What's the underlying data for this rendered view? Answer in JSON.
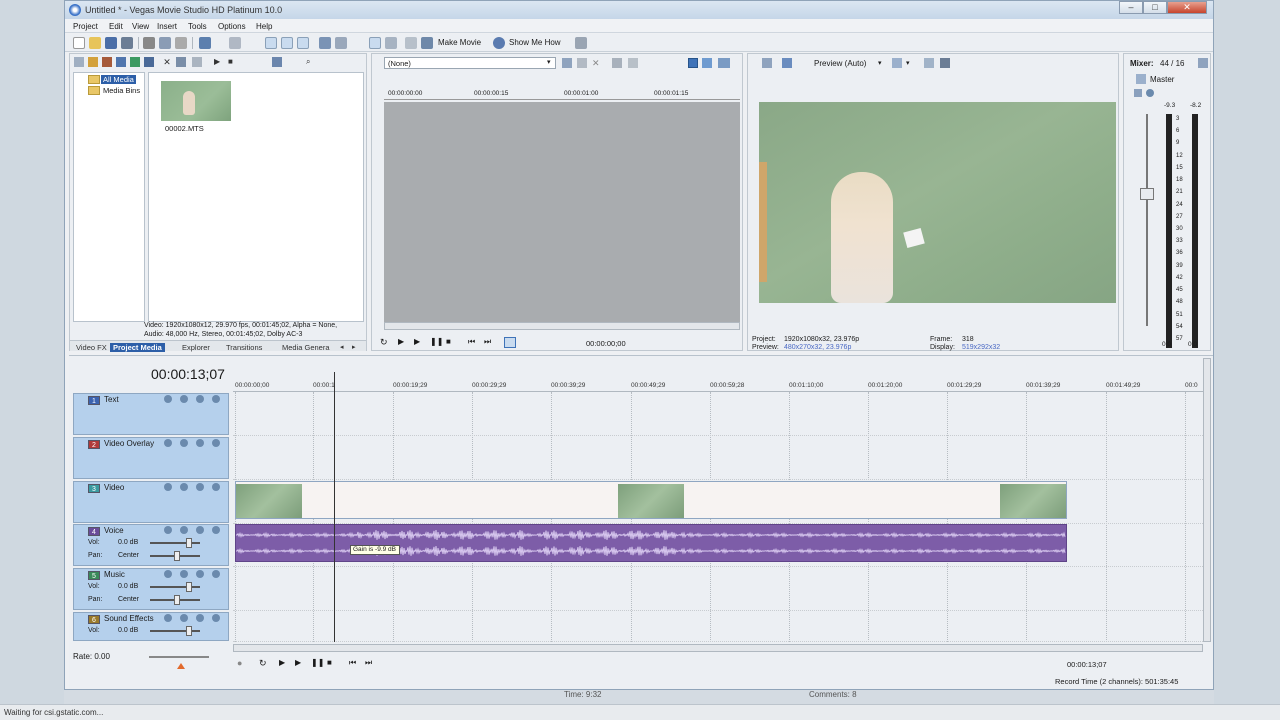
{
  "window": {
    "title": "Untitled * - Vegas Movie Studio HD Platinum 10.0"
  },
  "menu": [
    "Project",
    "Edit",
    "View",
    "Insert",
    "Tools",
    "Options",
    "Help"
  ],
  "toolbar": {
    "make_movie": "Make Movie",
    "show_me_how": "Show Me How"
  },
  "explorer": {
    "tree": [
      "All Media",
      "Media Bins"
    ],
    "file": "00002.MTS",
    "info_line1": "Video: 1920x1080x12, 29.970 fps, 00:01:45;02, Alpha = None,",
    "info_line2": "Audio: 48,000 Hz, Stereo, 00:01:45;02, Dolby AC-3",
    "tabs": [
      "Video FX",
      "Project Media",
      "Explorer",
      "Transitions",
      "Media Genera"
    ]
  },
  "trimmer": {
    "dropdown": "(None)",
    "ruler": [
      "00:00:00:00",
      "00:00:00:15",
      "00:00:01:00",
      "00:00:01:15"
    ],
    "time": "00:00:00;00"
  },
  "preview": {
    "label": "Preview (Auto)",
    "project_label": "Project:",
    "project_value": "1920x1080x32, 23.976p",
    "preview_label": "Preview:",
    "preview_value": "480x270x32, 23.976p",
    "frame_label": "Frame:",
    "frame_value": "318",
    "display_label": "Display:",
    "display_value": "519x292x32"
  },
  "mixer": {
    "label": "Mixer:",
    "count": "44 / 16",
    "master": "Master",
    "peak_left": "-9.3",
    "peak_right": "-8.2",
    "scale": [
      "3",
      "6",
      "9",
      "12",
      "15",
      "18",
      "21",
      "24",
      "27",
      "30",
      "33",
      "36",
      "39",
      "42",
      "45",
      "48",
      "51",
      "54",
      "57"
    ],
    "bottom_left": "0.0",
    "bottom_right": "0.0"
  },
  "timeline": {
    "timecode": "00:00:13;07",
    "ruler": [
      "00:00:00;00",
      "00:00:1",
      "00:00:19;29",
      "00:00:29;29",
      "00:00:39;29",
      "00:00:49;29",
      "00:00:59;28",
      "00:01:10;00",
      "00:01:20;00",
      "00:01:29;29",
      "00:01:39;29",
      "00:01:49;29",
      "00:0"
    ],
    "tracks": [
      {
        "num": "1",
        "name": "Text"
      },
      {
        "num": "2",
        "name": "Video Overlay"
      },
      {
        "num": "3",
        "name": "Video"
      },
      {
        "num": "4",
        "name": "Voice",
        "vol_label": "Vol:",
        "vol": "0.0 dB",
        "pan_label": "Pan:",
        "pan": "Center"
      },
      {
        "num": "5",
        "name": "Music",
        "vol_label": "Vol:",
        "vol": "0.0 dB",
        "pan_label": "Pan:",
        "pan": "Center"
      },
      {
        "num": "6",
        "name": "Sound Effects",
        "vol_label": "Vol:",
        "vol": "0.0 dB"
      }
    ],
    "tooltip": "Gain is -9.9 dB",
    "rate": "Rate: 0.00",
    "time_bottom": "00:00:13;07",
    "record_time": "Record Time (2 channels): 501:35:45"
  },
  "colors": {
    "audio_clip": "#7d5da8",
    "track_header": "#b5d0ec",
    "titlebar": "#c5d6e8"
  },
  "background": {
    "time_label": "Time: 9:32",
    "comments_label": "Comments: 8"
  },
  "status": "Waiting for csi.gstatic.com..."
}
